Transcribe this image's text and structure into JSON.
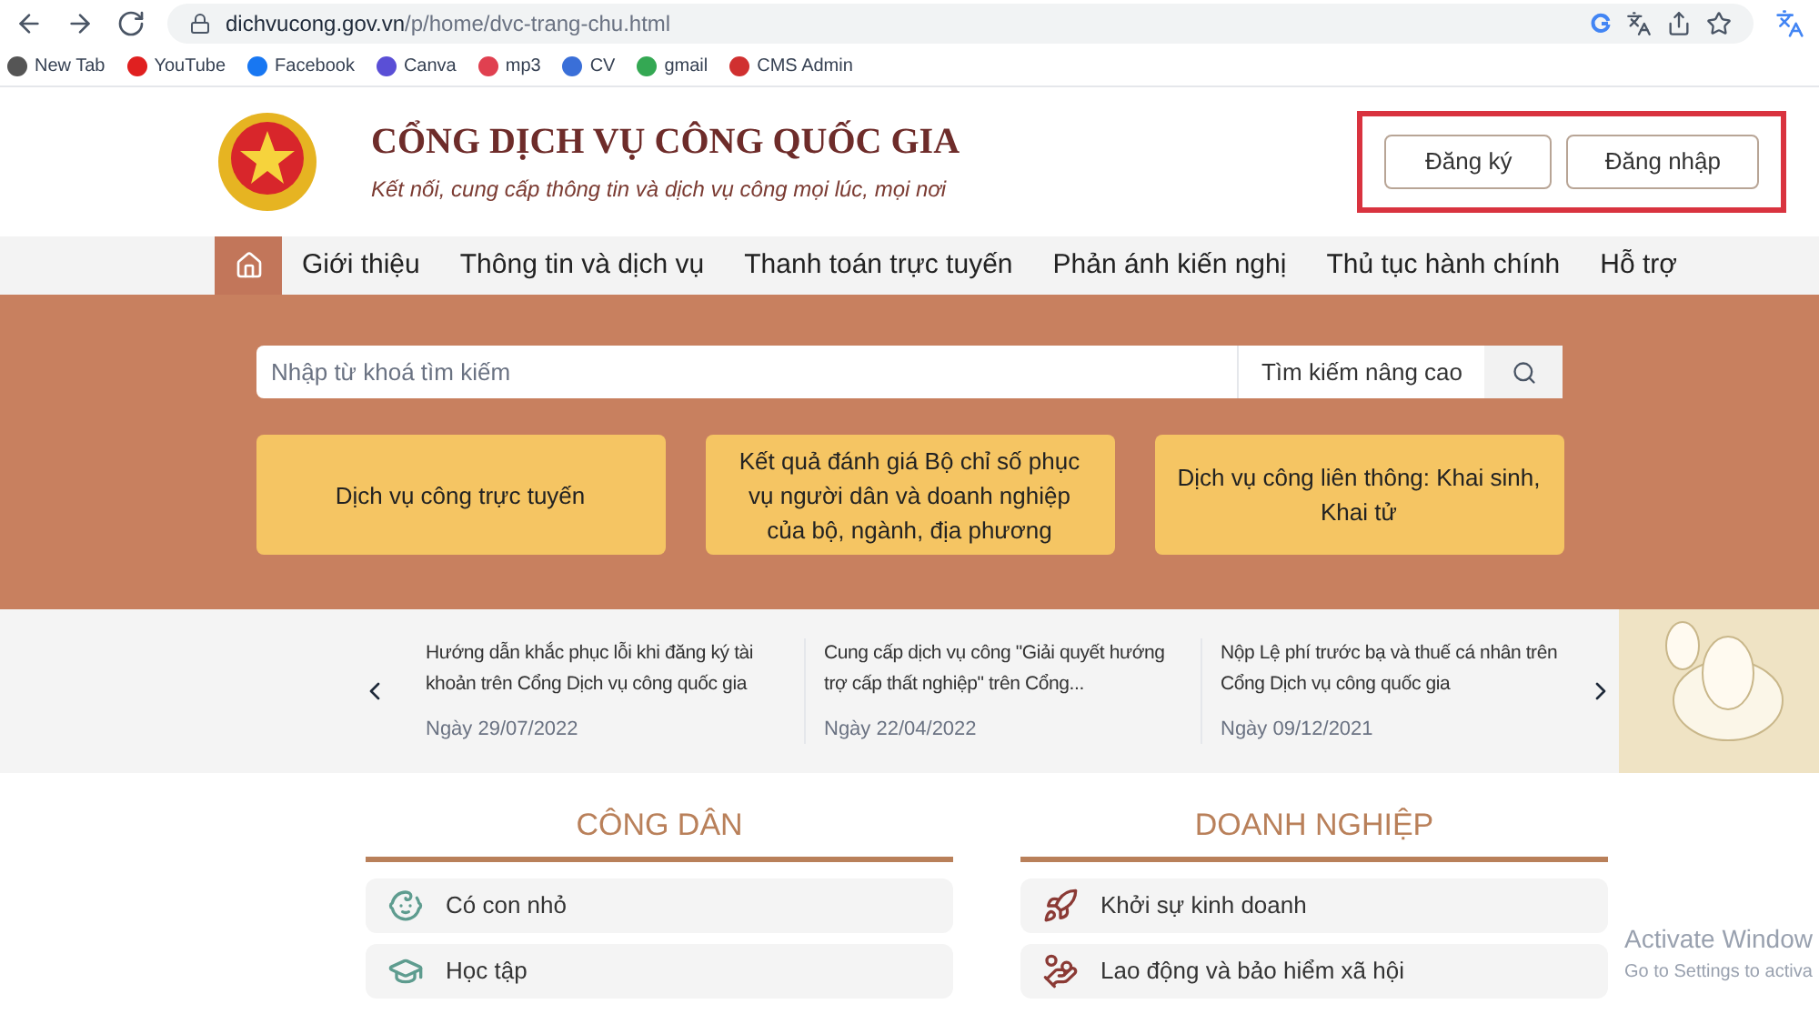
{
  "browser": {
    "url_host": "dichvucong.gov.vn",
    "url_path": "/p/home/dvc-trang-chu.html",
    "bookmarks": [
      {
        "label": "New Tab",
        "color": "#555555"
      },
      {
        "label": "YouTube",
        "color": "#e02020"
      },
      {
        "label": "Facebook",
        "color": "#1877f2"
      },
      {
        "label": "Canva",
        "color": "#5a4fd6"
      },
      {
        "label": "mp3",
        "color": "#e04050"
      },
      {
        "label": "CV",
        "color": "#3a6fd8"
      },
      {
        "label": "gmail",
        "color": "#34a853"
      },
      {
        "label": "CMS Admin",
        "color": "#d03030"
      }
    ]
  },
  "header": {
    "site_title": "CỔNG DỊCH VỤ CÔNG QUỐC GIA",
    "tagline": "Kết nối, cung cấp thông tin và dịch vụ công mọi lúc, mọi nơi",
    "buttons_highlighted": true,
    "buttons": [
      "Đăng ký",
      "Đăng nhập"
    ]
  },
  "nav": [
    {
      "kind": "home",
      "selected": true
    },
    {
      "kind": "text",
      "label": "Giới thiệu",
      "selected": false
    },
    {
      "kind": "text",
      "label": "Thông tin và dịch vụ",
      "selected": false
    },
    {
      "kind": "text",
      "label": "Thanh toán trực tuyến",
      "selected": false
    },
    {
      "kind": "text",
      "label": "Phản ánh kiến nghị",
      "selected": false
    },
    {
      "kind": "text",
      "label": "Thủ tục hành chính",
      "selected": false
    },
    {
      "kind": "text",
      "label": "Hỗ trợ",
      "selected": false
    }
  ],
  "search": {
    "placeholder": "Nhập từ khoá tìm kiếm",
    "advanced": "Tìm kiếm nâng cao"
  },
  "quick_links": [
    "Dịch vụ công trực tuyến",
    "Kết quả đánh giá Bộ chỉ số phục vụ người dân và doanh nghiệp của bộ, ngành, địa phương",
    "Dịch vụ công liên thông: Khai sinh, Khai tử"
  ],
  "news": [
    {
      "title": "Hướng dẫn khắc phục lỗi khi đăng ký tài khoản trên Cổng Dịch vụ công quốc gia",
      "date": "Ngày 29/07/2022"
    },
    {
      "title": "Cung cấp dịch vụ công \"Giải quyết hướng trợ cấp thất nghiệp\" trên Cổng...",
      "date": "Ngày 22/04/2022"
    },
    {
      "title": "Nộp Lệ phí trước bạ và thuế cá nhân trên Cổng Dịch vụ công quốc gia",
      "date": "Ngày 09/12/2021"
    }
  ],
  "sections": [
    {
      "title": "CÔNG DÂN",
      "items": [
        {
          "kind": "child",
          "label": "Có con nhỏ"
        },
        {
          "kind": "study",
          "label": "Học tập"
        }
      ]
    },
    {
      "title": "DOANH NGHIỆP",
      "items": [
        {
          "kind": "rocket",
          "label": "Khởi sự kinh doanh"
        },
        {
          "kind": "labor",
          "label": "Lao động và bảo hiểm xã hội"
        }
      ]
    }
  ],
  "os_overlay": {
    "title": "Activate Window",
    "subtitle": "Go to Settings to activa"
  }
}
